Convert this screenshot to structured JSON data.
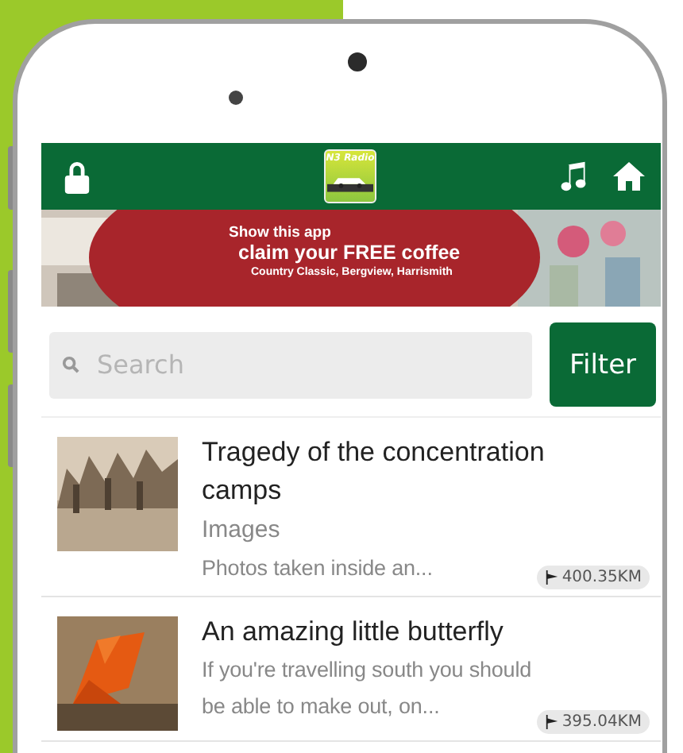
{
  "header": {
    "logo_text": "N3 Radio"
  },
  "banner": {
    "headline": "Show this app",
    "offer": "claim your FREE coffee",
    "location": "Country Classic, Bergview, Harrismith"
  },
  "search": {
    "placeholder": "Search"
  },
  "filter_button": "Filter",
  "items": [
    {
      "title": "Tragedy of the concentration camps",
      "category": "Images",
      "snippet": "Photos taken inside an...",
      "distance": "400.35KM",
      "kind": "sepia"
    },
    {
      "title": "An amazing little butterfly",
      "snippet": "If you're travelling south you should be able to make out, on...",
      "distance": "395.04KM",
      "kind": "butterfly"
    }
  ]
}
